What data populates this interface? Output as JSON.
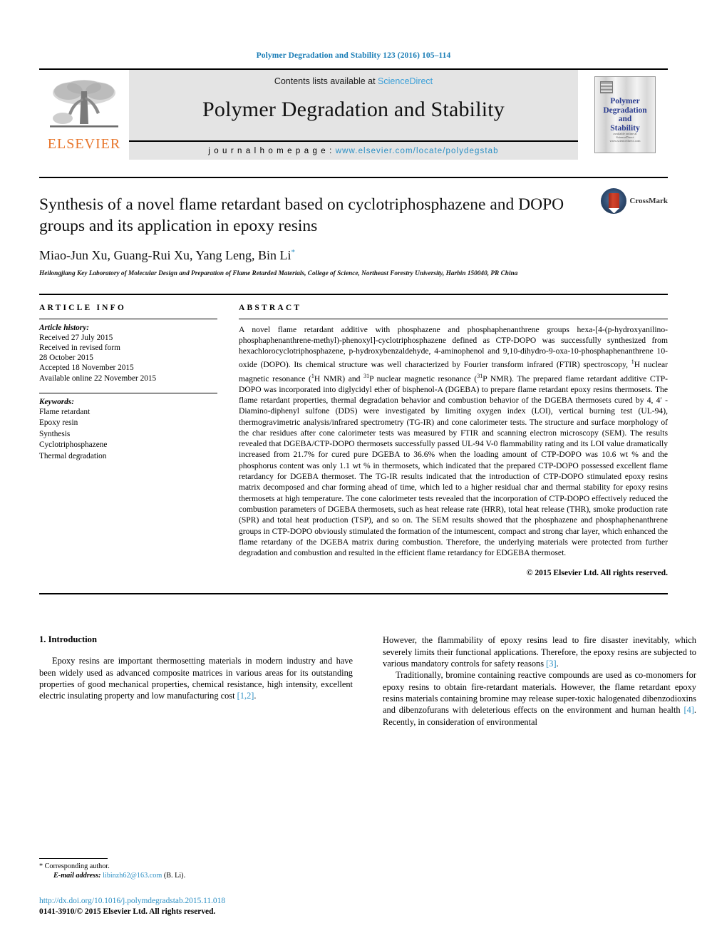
{
  "running_head": "Polymer Degradation and Stability 123 (2016) 105–114",
  "masthead": {
    "contents_prefix": "Contents lists available at ",
    "sciencedirect": "ScienceDirect",
    "journal_name": "Polymer Degradation and Stability",
    "homepage_label": "j o u r n a l   h o m e p a g e :   ",
    "homepage_url": "www.elsevier.com/locate/polydegstab",
    "publisher_logo_text": "ELSEVIER",
    "cover_title": "Polymer\nDegradation\nand\nStability",
    "cover_footer": "available online at\nScienceDirect\nwww.sciencedirect.com"
  },
  "article": {
    "title": "Synthesis of a novel flame retardant based on cyclotriphosphazene and DOPO groups and its application in epoxy resins",
    "authors": "Miao-Jun Xu, Guang-Rui Xu, Yang Leng, Bin Li",
    "corresponding_marker": "*",
    "affiliation": "Heilongjiang Key Laboratory of Molecular Design and Preparation of Flame Retarded Materials, College of Science, Northeast Forestry University, Harbin 150040, PR China",
    "crossmark_label": "CrossMark"
  },
  "article_info": {
    "heading": "ARTICLE INFO",
    "history_label": "Article history:",
    "history": [
      "Received 27 July 2015",
      "Received in revised form",
      "28 October 2015",
      "Accepted 18 November 2015",
      "Available online 22 November 2015"
    ],
    "keywords_label": "Keywords:",
    "keywords": [
      "Flame retardant",
      "Epoxy resin",
      "Synthesis",
      "Cyclotriphosphazene",
      "Thermal degradation"
    ]
  },
  "abstract": {
    "heading": "ABSTRACT",
    "paragraphs": [
      "A novel flame retardant additive with phosphazene and phosphaphenanthrene groups hexa-[4-(p-hydroxyanilino-phosphaphenanthrene-methyl)-phenoxyl]-cyclotriphosphazene defined as CTP-DOPO was successfully synthesized from hexachlorocyclotriphosphazene, p-hydroxybenzaldehyde, 4-aminophenol and 9,10-dihydro-9-oxa-10-phosphaphenanthrene 10-oxide (DOPO). Its chemical structure was well characterized by Fourier transform infrared (FTIR) spectroscopy, 1H nuclear magnetic resonance (1H NMR) and 31P nuclear magnetic resonance (31P NMR). The prepared flame retardant additive CTP-DOPO was incorporated into diglycidyl ether of bisphenol-A (DGEBA) to prepare flame retardant epoxy resins thermosets. The flame retardant properties, thermal degradation behavior and combustion behavior of the DGEBA thermosets cured by 4, 4′ -Diamino-diphenyl sulfone (DDS) were investigated by limiting oxygen index (LOI), vertical burning test (UL-94), thermogravimetric analysis/infrared spectrometry (TG-IR) and cone calorimeter tests. The structure and surface morphology of the char residues after cone calorimeter tests was measured by FTIR and scanning electron microscopy (SEM). The results revealed that DGEBA/CTP-DOPO thermosets successfully passed UL-94 V-0 flammability rating and its LOI value dramatically increased from 21.7% for cured pure DGEBA to 36.6% when the loading amount of CTP-DOPO was 10.6 wt % and the phosphorus content was only 1.1 wt % in thermosets, which indicated that the prepared CTP-DOPO possessed excellent flame retardancy for DGEBA thermoset. The TG-IR results indicated that the introduction of CTP-DOPO stimulated epoxy resins matrix decomposed and char forming ahead of time, which led to a higher residual char and thermal stability for epoxy resins thermosets at high temperature. The cone calorimeter tests revealed that the incorporation of CTP-DOPO effectively reduced the combustion parameters of DGEBA thermosets, such as heat release rate (HRR), total heat release (THR), smoke production rate (SPR) and total heat production (TSP), and so on. The SEM results showed that the phosphazene and phosphaphenanthrene groups in CTP-DOPO obviously stimulated the formation of the intumescent, compact and strong char layer, which enhanced the flame retardany of the DGEBA matrix during combustion. Therefore, the underlying materials were protected from further degradation and combustion and resulted in the efficient flame retardancy for EDGEBA thermoset."
    ],
    "copyright": "© 2015 Elsevier Ltd. All rights reserved."
  },
  "introduction": {
    "section_number_title": "1.  Introduction",
    "left_paragraphs": [
      "Epoxy resins are important thermosetting materials in modern industry and have been widely used as advanced composite matrices in various areas for its outstanding properties of good mechanical properties, chemical resistance, high intensity, excellent electric insulating property and low manufacturing cost [1,2]."
    ],
    "right_paragraphs": [
      "However, the flammability of epoxy resins lead to fire disaster inevitably, which severely limits their functional applications. Therefore, the epoxy resins are subjected to various mandatory controls for safety reasons [3].",
      "Traditionally, bromine containing reactive compounds are used as co-monomers for epoxy resins to obtain fire-retardant materials. However, the flame retardant epoxy resins materials containing bromine may release super-toxic halogenated dibenzodioxins and dibenzofurans with deleterious effects on the environment and human health [4]. Recently, in consideration of environmental"
    ],
    "refs": {
      "r12": "[1,2]",
      "r3": "[3]",
      "r4": "[4]"
    }
  },
  "footnote": {
    "corresponding_marker": "*",
    "corresponding_text": "Corresponding author.",
    "email_label": "E-mail address:",
    "email": "libinzh62@163.com",
    "email_owner": "(B. Li)."
  },
  "doi": {
    "url": "http://dx.doi.org/10.1016/j.polymdegradstab.2015.11.018",
    "issn_line": "0141-3910/© 2015 Elsevier Ltd. All rights reserved."
  },
  "colors": {
    "link_blue": "#2b8fc4",
    "sciencedirect_blue": "#3ca0d8",
    "elsevier_orange": "#e8762c",
    "cover_navy": "#2b3d8f",
    "masthead_grey": "#e4e4e4"
  }
}
